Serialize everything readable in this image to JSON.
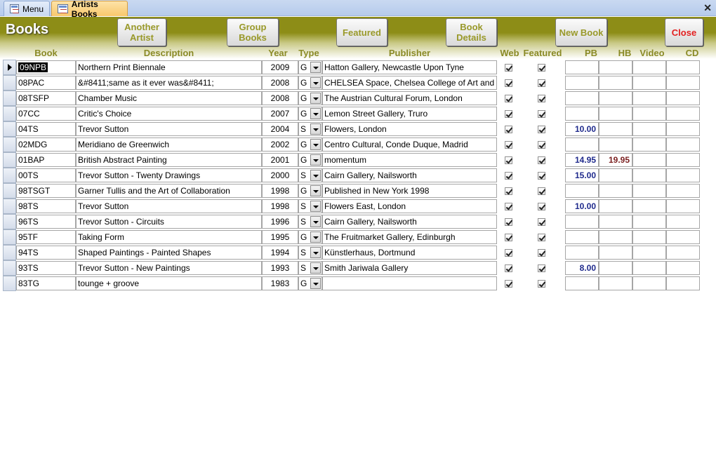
{
  "tabs": {
    "menu_label": "Menu",
    "active_label": "Artists Books",
    "close_glyph": "✕"
  },
  "header": {
    "title": "Books",
    "buttons": {
      "another_artist": "Another Artist",
      "group_books": "Group Books",
      "featured": "Featured",
      "book_details": "Book Details",
      "new_book": "New Book",
      "close": "Close"
    }
  },
  "columns": {
    "book": "Book",
    "description": "Description",
    "year": "Year",
    "type": "Type",
    "publisher": "Publisher",
    "web": "Web",
    "featured": "Featured",
    "pb": "PB",
    "hb": "HB",
    "video": "Video",
    "cd": "CD"
  },
  "rows": [
    {
      "book": "09NPB",
      "description": "Northern Print Biennale",
      "year": "2009",
      "type": "G",
      "publisher": "Hatton Gallery, Newcastle Upon Tyne",
      "web": true,
      "featured": true,
      "pb": "",
      "hb": "",
      "video": "",
      "cd": ""
    },
    {
      "book": "08PAC",
      "description": "&#8411;same as it ever was&#8411;",
      "year": "2008",
      "type": "G",
      "publisher": "CHELSEA Space, Chelsea College of Art and",
      "web": true,
      "featured": true,
      "pb": "",
      "hb": "",
      "video": "",
      "cd": ""
    },
    {
      "book": "08TSFP",
      "description": "Chamber Music",
      "year": "2008",
      "type": "G",
      "publisher": "The Austrian Cultural Forum, London",
      "web": true,
      "featured": true,
      "pb": "",
      "hb": "",
      "video": "",
      "cd": ""
    },
    {
      "book": "07CC",
      "description": "Critic's Choice",
      "year": "2007",
      "type": "G",
      "publisher": "Lemon Street Gallery, Truro",
      "web": true,
      "featured": true,
      "pb": "",
      "hb": "",
      "video": "",
      "cd": ""
    },
    {
      "book": "04TS",
      "description": "Trevor Sutton",
      "year": "2004",
      "type": "S",
      "publisher": "Flowers, London",
      "web": true,
      "featured": true,
      "pb": "10.00",
      "hb": "",
      "video": "",
      "cd": ""
    },
    {
      "book": "02MDG",
      "description": "Meridiano de Greenwich",
      "year": "2002",
      "type": "G",
      "publisher": "Centro Cultural, Conde Duque, Madrid",
      "web": true,
      "featured": true,
      "pb": "",
      "hb": "",
      "video": "",
      "cd": ""
    },
    {
      "book": "01BAP",
      "description": "British Abstract Painting",
      "year": "2001",
      "type": "G",
      "publisher": "momentum",
      "web": true,
      "featured": true,
      "pb": "14.95",
      "hb": "19.95",
      "video": "",
      "cd": ""
    },
    {
      "book": "00TS",
      "description": "Trevor Sutton - Twenty Drawings",
      "year": "2000",
      "type": "S",
      "publisher": "Cairn Gallery, Nailsworth",
      "web": true,
      "featured": true,
      "pb": "15.00",
      "hb": "",
      "video": "",
      "cd": ""
    },
    {
      "book": "98TSGT",
      "description": "Garner Tullis and the Art of Collaboration",
      "year": "1998",
      "type": "G",
      "publisher": "Published in New York 1998",
      "web": true,
      "featured": true,
      "pb": "",
      "hb": "",
      "video": "",
      "cd": ""
    },
    {
      "book": "98TS",
      "description": "Trevor Sutton",
      "year": "1998",
      "type": "S",
      "publisher": "Flowers East, London",
      "web": true,
      "featured": true,
      "pb": "10.00",
      "hb": "",
      "video": "",
      "cd": ""
    },
    {
      "book": "96TS",
      "description": "Trevor Sutton - Circuits",
      "year": "1996",
      "type": "S",
      "publisher": "Cairn Gallery, Nailsworth",
      "web": true,
      "featured": true,
      "pb": "",
      "hb": "",
      "video": "",
      "cd": ""
    },
    {
      "book": "95TF",
      "description": "Taking Form",
      "year": "1995",
      "type": "G",
      "publisher": "The Fruitmarket Gallery, Edinburgh",
      "web": true,
      "featured": true,
      "pb": "",
      "hb": "",
      "video": "",
      "cd": ""
    },
    {
      "book": "94TS",
      "description": "Shaped Paintings - Painted Shapes",
      "year": "1994",
      "type": "S",
      "publisher": "Künstlerhaus, Dortmund",
      "web": true,
      "featured": true,
      "pb": "",
      "hb": "",
      "video": "",
      "cd": ""
    },
    {
      "book": "93TS",
      "description": "Trevor Sutton - New Paintings",
      "year": "1993",
      "type": "S",
      "publisher": "Smith Jariwala Gallery",
      "web": true,
      "featured": true,
      "pb": "8.00",
      "hb": "",
      "video": "",
      "cd": ""
    },
    {
      "book": "83TG",
      "description": "tounge + groove",
      "year": "1983",
      "type": "G",
      "publisher": "",
      "web": true,
      "featured": true,
      "pb": "",
      "hb": "",
      "video": "",
      "cd": ""
    }
  ]
}
